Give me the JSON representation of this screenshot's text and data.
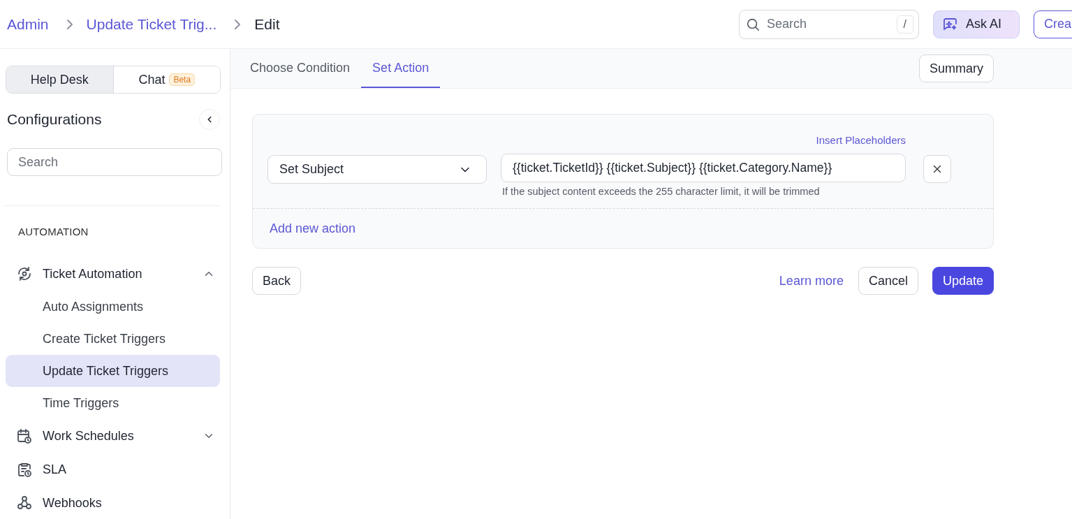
{
  "breadcrumbs": [
    {
      "label": "Admin",
      "kind": "link"
    },
    {
      "label": "Update Ticket Trig...",
      "kind": "link"
    },
    {
      "label": "Edit",
      "kind": "current"
    }
  ],
  "header": {
    "search": {
      "placeholder": "Search",
      "shortcut": "/"
    },
    "ask_ai": "Ask AI",
    "create_button": "Crea"
  },
  "sidebar": {
    "mode_tabs": [
      {
        "label": "Help Desk",
        "selected": true
      },
      {
        "label": "Chat",
        "badge": "Beta",
        "selected": false
      }
    ],
    "title": "Configurations",
    "search": {
      "placeholder": "Search"
    },
    "section": "AUTOMATION",
    "items": [
      {
        "label": "Ticket Automation",
        "kind": "automation",
        "expanded": true,
        "children": [
          {
            "label": "Auto Assignments",
            "selected": false
          },
          {
            "label": "Create Ticket Triggers",
            "selected": false
          },
          {
            "label": "Update Ticket Triggers",
            "selected": true
          },
          {
            "label": "Time Triggers",
            "selected": false
          }
        ]
      },
      {
        "label": "Work Schedules",
        "kind": "calendar",
        "expanded": false
      },
      {
        "label": "SLA",
        "kind": "clipboard"
      },
      {
        "label": "Webhooks",
        "kind": "webhook"
      }
    ]
  },
  "tabs": [
    {
      "label": "Choose Condition",
      "selected": false
    },
    {
      "label": "Set Action",
      "selected": true
    }
  ],
  "summary_button": "Summary",
  "actions": [
    {
      "type": "Set Subject",
      "link": "Insert Placeholders",
      "value": "{{ticket.TicketId}} {{ticket.Subject}} {{ticket.Category.Name}}",
      "hint": "If the subject content exceeds the 255 character limit, it will be trimmed"
    }
  ],
  "add_action": "Add new action",
  "buttons": {
    "back": "Back",
    "learn_more": "Learn more",
    "cancel": "Cancel",
    "update": "Update"
  }
}
